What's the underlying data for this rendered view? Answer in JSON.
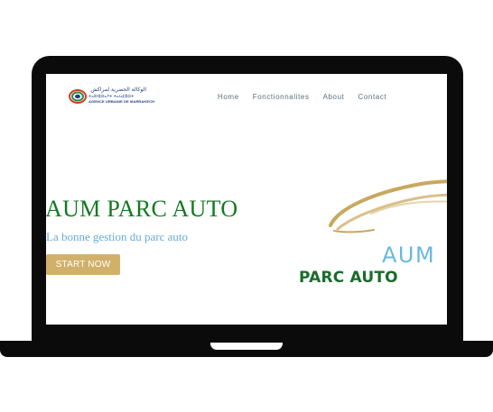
{
  "header": {
    "logo": {
      "arabic_text": "الوكالة الحضرية لمراكش",
      "tifinagh_text": "ⵜⴰⵙⵏⵓⵔⴰⵢⵜ ⵜⴰⵏⴰⵎⵓⵔⵜ",
      "french_text": "AGENCE URBAINE DE MARRAKECH"
    },
    "nav": [
      {
        "label": "Home"
      },
      {
        "label": "Fonctionnalites"
      },
      {
        "label": "About"
      },
      {
        "label": "Contact"
      }
    ]
  },
  "hero": {
    "title": "AUM PARC AUTO",
    "subtitle": "La bonne gestion du parc auto",
    "cta_label": "START NOW"
  },
  "brand_logo": {
    "aum_text": "AUM",
    "parc_text": "PARC AUTO"
  },
  "colors": {
    "title_green": "#127a22",
    "subtitle_blue": "#6aaad6",
    "button_gold": "#d1b06a",
    "logo_gold": "#c8a85e"
  }
}
